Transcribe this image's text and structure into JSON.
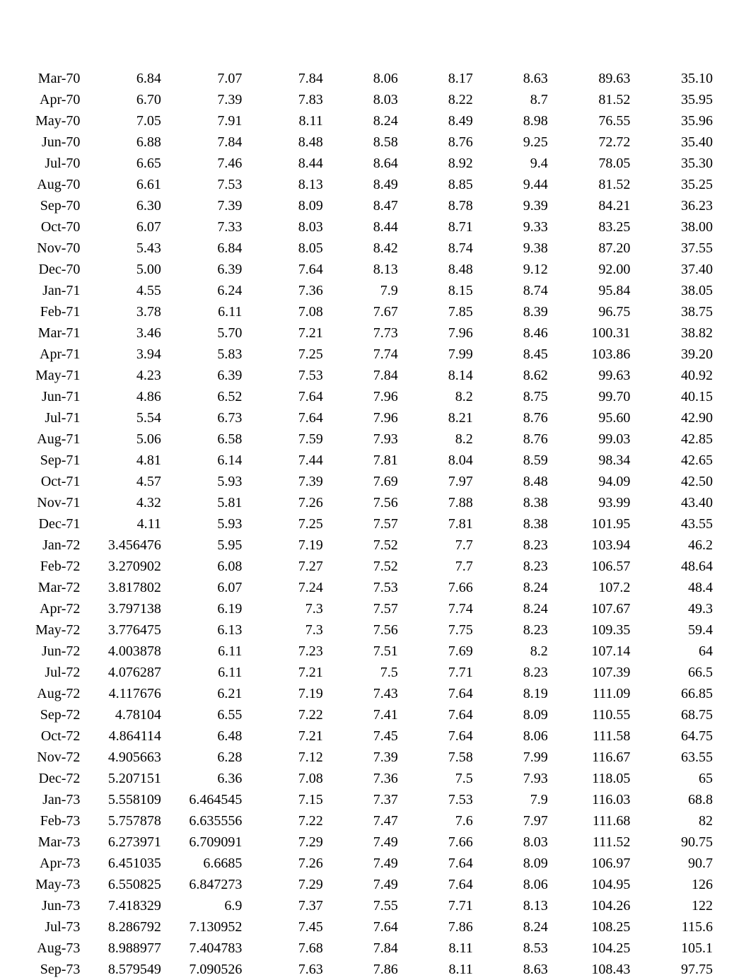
{
  "rows": [
    {
      "label": "Mar-70",
      "c1": "6.84",
      "c2": "7.07",
      "c3": "7.84",
      "c4": "8.06",
      "c5": "8.17",
      "c6": "8.63",
      "c7": "89.63",
      "c8": "35.10"
    },
    {
      "label": "Apr-70",
      "c1": "6.70",
      "c2": "7.39",
      "c3": "7.83",
      "c4": "8.03",
      "c5": "8.22",
      "c6": "8.7",
      "c7": "81.52",
      "c8": "35.95"
    },
    {
      "label": "May-70",
      "c1": "7.05",
      "c2": "7.91",
      "c3": "8.11",
      "c4": "8.24",
      "c5": "8.49",
      "c6": "8.98",
      "c7": "76.55",
      "c8": "35.96"
    },
    {
      "label": "Jun-70",
      "c1": "6.88",
      "c2": "7.84",
      "c3": "8.48",
      "c4": "8.58",
      "c5": "8.76",
      "c6": "9.25",
      "c7": "72.72",
      "c8": "35.40"
    },
    {
      "label": "Jul-70",
      "c1": "6.65",
      "c2": "7.46",
      "c3": "8.44",
      "c4": "8.64",
      "c5": "8.92",
      "c6": "9.4",
      "c7": "78.05",
      "c8": "35.30"
    },
    {
      "label": "Aug-70",
      "c1": "6.61",
      "c2": "7.53",
      "c3": "8.13",
      "c4": "8.49",
      "c5": "8.85",
      "c6": "9.44",
      "c7": "81.52",
      "c8": "35.25"
    },
    {
      "label": "Sep-70",
      "c1": "6.30",
      "c2": "7.39",
      "c3": "8.09",
      "c4": "8.47",
      "c5": "8.78",
      "c6": "9.39",
      "c7": "84.21",
      "c8": "36.23"
    },
    {
      "label": "Oct-70",
      "c1": "6.07",
      "c2": "7.33",
      "c3": "8.03",
      "c4": "8.44",
      "c5": "8.71",
      "c6": "9.33",
      "c7": "83.25",
      "c8": "38.00"
    },
    {
      "label": "Nov-70",
      "c1": "5.43",
      "c2": "6.84",
      "c3": "8.05",
      "c4": "8.42",
      "c5": "8.74",
      "c6": "9.38",
      "c7": "87.20",
      "c8": "37.55"
    },
    {
      "label": "Dec-70",
      "c1": "5.00",
      "c2": "6.39",
      "c3": "7.64",
      "c4": "8.13",
      "c5": "8.48",
      "c6": "9.12",
      "c7": "92.00",
      "c8": "37.40"
    },
    {
      "label": "Jan-71",
      "c1": "4.55",
      "c2": "6.24",
      "c3": "7.36",
      "c4": "7.9",
      "c5": "8.15",
      "c6": "8.74",
      "c7": "95.84",
      "c8": "38.05"
    },
    {
      "label": "Feb-71",
      "c1": "3.78",
      "c2": "6.11",
      "c3": "7.08",
      "c4": "7.67",
      "c5": "7.85",
      "c6": "8.39",
      "c7": "96.75",
      "c8": "38.75"
    },
    {
      "label": "Mar-71",
      "c1": "3.46",
      "c2": "5.70",
      "c3": "7.21",
      "c4": "7.73",
      "c5": "7.96",
      "c6": "8.46",
      "c7": "100.31",
      "c8": "38.82"
    },
    {
      "label": "Apr-71",
      "c1": "3.94",
      "c2": "5.83",
      "c3": "7.25",
      "c4": "7.74",
      "c5": "7.99",
      "c6": "8.45",
      "c7": "103.86",
      "c8": "39.20"
    },
    {
      "label": "May-71",
      "c1": "4.23",
      "c2": "6.39",
      "c3": "7.53",
      "c4": "7.84",
      "c5": "8.14",
      "c6": "8.62",
      "c7": "99.63",
      "c8": "40.92"
    },
    {
      "label": "Jun-71",
      "c1": "4.86",
      "c2": "6.52",
      "c3": "7.64",
      "c4": "7.96",
      "c5": "8.2",
      "c6": "8.75",
      "c7": "99.70",
      "c8": "40.15"
    },
    {
      "label": "Jul-71",
      "c1": "5.54",
      "c2": "6.73",
      "c3": "7.64",
      "c4": "7.96",
      "c5": "8.21",
      "c6": "8.76",
      "c7": "95.60",
      "c8": "42.90"
    },
    {
      "label": "Aug-71",
      "c1": "5.06",
      "c2": "6.58",
      "c3": "7.59",
      "c4": "7.93",
      "c5": "8.2",
      "c6": "8.76",
      "c7": "99.03",
      "c8": "42.85"
    },
    {
      "label": "Sep-71",
      "c1": "4.81",
      "c2": "6.14",
      "c3": "7.44",
      "c4": "7.81",
      "c5": "8.04",
      "c6": "8.59",
      "c7": "98.34",
      "c8": "42.65"
    },
    {
      "label": "Oct-71",
      "c1": "4.57",
      "c2": "5.93",
      "c3": "7.39",
      "c4": "7.69",
      "c5": "7.97",
      "c6": "8.48",
      "c7": "94.09",
      "c8": "42.50"
    },
    {
      "label": "Nov-71",
      "c1": "4.32",
      "c2": "5.81",
      "c3": "7.26",
      "c4": "7.56",
      "c5": "7.88",
      "c6": "8.38",
      "c7": "93.99",
      "c8": "43.40"
    },
    {
      "label": "Dec-71",
      "c1": "4.11",
      "c2": "5.93",
      "c3": "7.25",
      "c4": "7.57",
      "c5": "7.81",
      "c6": "8.38",
      "c7": "101.95",
      "c8": "43.55"
    },
    {
      "label": "Jan-72",
      "c1": "3.456476",
      "c2": "5.95",
      "c3": "7.19",
      "c4": "7.52",
      "c5": "7.7",
      "c6": "8.23",
      "c7": "103.94",
      "c8": "46.2"
    },
    {
      "label": "Feb-72",
      "c1": "3.270902",
      "c2": "6.08",
      "c3": "7.27",
      "c4": "7.52",
      "c5": "7.7",
      "c6": "8.23",
      "c7": "106.57",
      "c8": "48.64"
    },
    {
      "label": "Mar-72",
      "c1": "3.817802",
      "c2": "6.07",
      "c3": "7.24",
      "c4": "7.53",
      "c5": "7.66",
      "c6": "8.24",
      "c7": "107.2",
      "c8": "48.4"
    },
    {
      "label": "Apr-72",
      "c1": "3.797138",
      "c2": "6.19",
      "c3": "7.3",
      "c4": "7.57",
      "c5": "7.74",
      "c6": "8.24",
      "c7": "107.67",
      "c8": "49.3"
    },
    {
      "label": "May-72",
      "c1": "3.776475",
      "c2": "6.13",
      "c3": "7.3",
      "c4": "7.56",
      "c5": "7.75",
      "c6": "8.23",
      "c7": "109.35",
      "c8": "59.4"
    },
    {
      "label": "Jun-72",
      "c1": "4.003878",
      "c2": "6.11",
      "c3": "7.23",
      "c4": "7.51",
      "c5": "7.69",
      "c6": "8.2",
      "c7": "107.14",
      "c8": "64"
    },
    {
      "label": "Jul-72",
      "c1": "4.076287",
      "c2": "6.11",
      "c3": "7.21",
      "c4": "7.5",
      "c5": "7.71",
      "c6": "8.23",
      "c7": "107.39",
      "c8": "66.5"
    },
    {
      "label": "Aug-72",
      "c1": "4.117676",
      "c2": "6.21",
      "c3": "7.19",
      "c4": "7.43",
      "c5": "7.64",
      "c6": "8.19",
      "c7": "111.09",
      "c8": "66.85"
    },
    {
      "label": "Sep-72",
      "c1": "4.78104",
      "c2": "6.55",
      "c3": "7.22",
      "c4": "7.41",
      "c5": "7.64",
      "c6": "8.09",
      "c7": "110.55",
      "c8": "68.75"
    },
    {
      "label": "Oct-72",
      "c1": "4.864114",
      "c2": "6.48",
      "c3": "7.21",
      "c4": "7.45",
      "c5": "7.64",
      "c6": "8.06",
      "c7": "111.58",
      "c8": "64.75"
    },
    {
      "label": "Nov-72",
      "c1": "4.905663",
      "c2": "6.28",
      "c3": "7.12",
      "c4": "7.39",
      "c5": "7.58",
      "c6": "7.99",
      "c7": "116.67",
      "c8": "63.55"
    },
    {
      "label": "Dec-72",
      "c1": "5.207151",
      "c2": "6.36",
      "c3": "7.08",
      "c4": "7.36",
      "c5": "7.5",
      "c6": "7.93",
      "c7": "118.05",
      "c8": "65"
    },
    {
      "label": "Jan-73",
      "c1": "5.558109",
      "c2": "6.464545",
      "c3": "7.15",
      "c4": "7.37",
      "c5": "7.53",
      "c6": "7.9",
      "c7": "116.03",
      "c8": "68.8"
    },
    {
      "label": "Feb-73",
      "c1": "5.757878",
      "c2": "6.635556",
      "c3": "7.22",
      "c4": "7.47",
      "c5": "7.6",
      "c6": "7.97",
      "c7": "111.68",
      "c8": "82"
    },
    {
      "label": "Mar-73",
      "c1": "6.273971",
      "c2": "6.709091",
      "c3": "7.29",
      "c4": "7.49",
      "c5": "7.66",
      "c6": "8.03",
      "c7": "111.52",
      "c8": "90.75"
    },
    {
      "label": "Apr-73",
      "c1": "6.451035",
      "c2": "6.6685",
      "c3": "7.26",
      "c4": "7.49",
      "c5": "7.64",
      "c6": "8.09",
      "c7": "106.97",
      "c8": "90.7"
    },
    {
      "label": "May-73",
      "c1": "6.550825",
      "c2": "6.847273",
      "c3": "7.29",
      "c4": "7.49",
      "c5": "7.64",
      "c6": "8.06",
      "c7": "104.95",
      "c8": "126"
    },
    {
      "label": "Jun-73",
      "c1": "7.418329",
      "c2": "6.9",
      "c3": "7.37",
      "c4": "7.55",
      "c5": "7.71",
      "c6": "8.13",
      "c7": "104.26",
      "c8": "122"
    },
    {
      "label": "Jul-73",
      "c1": "8.286792",
      "c2": "7.130952",
      "c3": "7.45",
      "c4": "7.64",
      "c5": "7.86",
      "c6": "8.24",
      "c7": "108.25",
      "c8": "115.6"
    },
    {
      "label": "Aug-73",
      "c1": "8.988977",
      "c2": "7.404783",
      "c3": "7.68",
      "c4": "7.84",
      "c5": "8.11",
      "c6": "8.53",
      "c7": "104.25",
      "c8": "105.1"
    },
    {
      "label": "Sep-73",
      "c1": "8.579549",
      "c2": "7.090526",
      "c3": "7.63",
      "c4": "7.86",
      "c5": "8.11",
      "c6": "8.63",
      "c7": "108.43",
      "c8": "97.75"
    }
  ]
}
